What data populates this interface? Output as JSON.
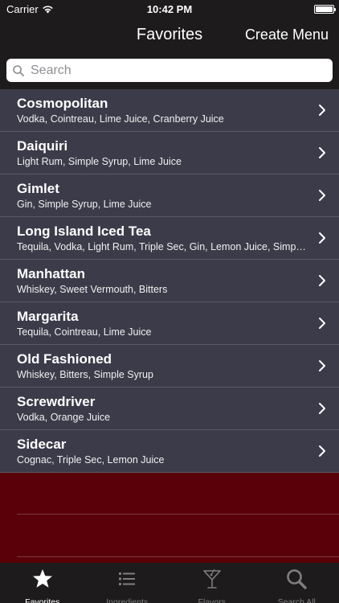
{
  "status_bar": {
    "carrier": "Carrier",
    "time": "10:42 PM",
    "battery_level": 1.0
  },
  "nav": {
    "title": "Favorites",
    "action_label": "Create Menu"
  },
  "search": {
    "placeholder": "Search"
  },
  "cocktails": [
    {
      "name": "Cosmopolitan",
      "ingredients": "Vodka, Cointreau, Lime Juice, Cranberry Juice"
    },
    {
      "name": "Daiquiri",
      "ingredients": "Light Rum, Simple Syrup, Lime Juice"
    },
    {
      "name": "Gimlet",
      "ingredients": "Gin, Simple Syrup, Lime Juice"
    },
    {
      "name": "Long Island Iced Tea",
      "ingredients": "Tequila, Vodka, Light Rum, Triple Sec, Gin, Lemon Juice, Simpl…"
    },
    {
      "name": "Manhattan",
      "ingredients": "Whiskey, Sweet Vermouth, Bitters"
    },
    {
      "name": "Margarita",
      "ingredients": "Tequila, Cointreau, Lime Juice"
    },
    {
      "name": "Old Fashioned",
      "ingredients": "Whiskey, Bitters, Simple Syrup"
    },
    {
      "name": "Screwdriver",
      "ingredients": "Vodka, Orange Juice"
    },
    {
      "name": "Sidecar",
      "ingredients": "Cognac, Triple Sec, Lemon Juice"
    }
  ],
  "tabs": [
    {
      "label": "Favorites",
      "icon": "star-icon",
      "active": true
    },
    {
      "label": "Ingredients",
      "icon": "list-icon",
      "active": false
    },
    {
      "label": "Flavors",
      "icon": "martini-glass-icon",
      "active": false
    },
    {
      "label": "Search All",
      "icon": "search-icon",
      "active": false
    }
  ],
  "colors": {
    "bar_background": "#1d1b1b",
    "list_background": "#3c3b4a",
    "empty_area": "#5a0008",
    "tab_active": "#ffffff",
    "tab_inactive": "#7f7f7f"
  }
}
